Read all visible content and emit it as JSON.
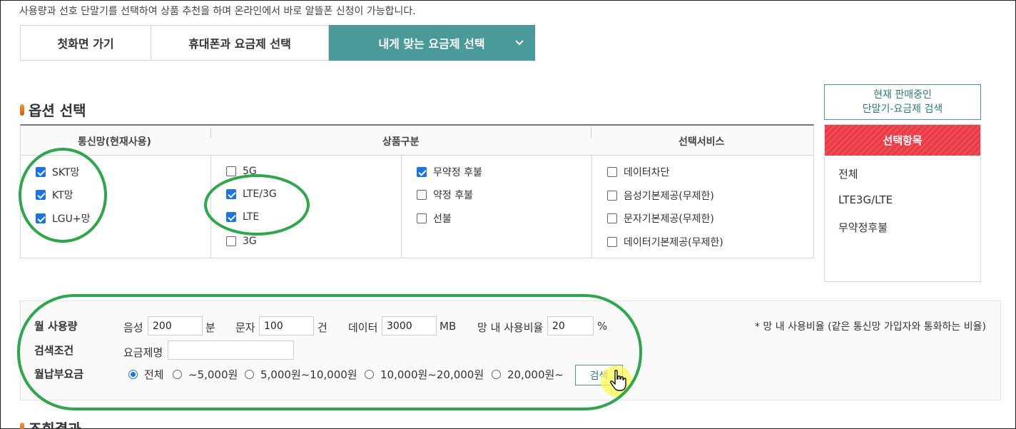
{
  "intro": "사용량과 선호 단말기를 선택하여 상품 추천을 하며 온라인에서 바로 알뜰폰 신청이 가능합니다.",
  "tabs": [
    {
      "label": "첫화면 가기",
      "active": false
    },
    {
      "label": "휴대폰과 요금제 선택",
      "active": false
    },
    {
      "label": "내게 맞는 요금제 선택",
      "active": true
    }
  ],
  "option_section": {
    "title": "옵션 선택",
    "headers": [
      "통신망(현재사용)",
      "상품구분",
      "선택서비스"
    ],
    "network": [
      {
        "label": "SKT망",
        "checked": true
      },
      {
        "label": "KT망",
        "checked": true
      },
      {
        "label": "LGU+망",
        "checked": true
      }
    ],
    "product_tech": [
      {
        "label": "5G",
        "checked": false
      },
      {
        "label": "LTE/3G",
        "checked": true
      },
      {
        "label": "LTE",
        "checked": true
      },
      {
        "label": "3G",
        "checked": false
      }
    ],
    "product_contract": [
      {
        "label": "무약정 후불",
        "checked": true
      },
      {
        "label": "약정 후불",
        "checked": false
      },
      {
        "label": "선불",
        "checked": false
      }
    ],
    "services": [
      {
        "label": "데이터차단",
        "checked": false
      },
      {
        "label": "음성기본제공(무제한)",
        "checked": false
      },
      {
        "label": "문자기본제공(무제한)",
        "checked": false
      },
      {
        "label": "데이터기본제공(무제한)",
        "checked": false
      }
    ]
  },
  "side": {
    "search_line1": "현재 판매중인",
    "search_line2": "단말기-요금제 검색",
    "selected_header": "선택항목",
    "selected_items": [
      "전체",
      "LTE3G/LTE",
      "무약정후불"
    ]
  },
  "conditions": {
    "usage_label": "월 사용량",
    "voice_label": "음성",
    "voice_value": "200",
    "voice_unit": "분",
    "sms_label": "문자",
    "sms_value": "100",
    "sms_unit": "건",
    "data_label": "데이터",
    "data_value": "3000",
    "data_unit": "MB",
    "ratio_label": "망 내 사용비율",
    "ratio_value": "20",
    "ratio_unit": "%",
    "note": "* 망 내 사용비율 (같은 통신망 가입자와 통화하는 비율)",
    "search_label": "검색조건",
    "plan_name_label": "요금제명",
    "plan_name_value": "",
    "fee_label": "월납부요금",
    "fee_options": [
      {
        "label": "전체",
        "selected": true
      },
      {
        "label": "~5,000원",
        "selected": false
      },
      {
        "label": "5,000원~10,000원",
        "selected": false
      },
      {
        "label": "10,000원~20,000원",
        "selected": false
      },
      {
        "label": "20,000원~",
        "selected": false
      }
    ],
    "search_button": "검색"
  },
  "result_title": "조회결과",
  "colors": {
    "teal": "#4a9a9a",
    "red_header": "#e83b45",
    "annotation_green": "#2aa84a",
    "checkbox_blue": "#1a73e8"
  }
}
